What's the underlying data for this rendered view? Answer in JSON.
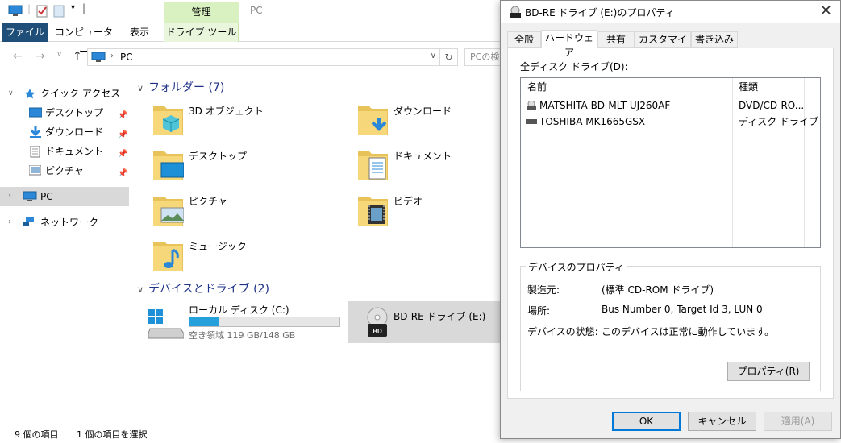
{
  "explorer": {
    "title": "PC",
    "ribbon_context": "管理",
    "tabs": [
      "ファイル",
      "コンピューター",
      "表示",
      "ドライブ ツール"
    ],
    "address": "PC",
    "search_placeholder": "PCの検",
    "nav": {
      "quick_access": "クイック アクセス",
      "desktop": "デスクトップ",
      "downloads": "ダウンロード",
      "documents": "ドキュメント",
      "pictures": "ピクチャ",
      "pc": "PC",
      "network": "ネットワーク"
    },
    "folders_header": "フォルダー (7)",
    "folders": [
      "3D オブジェクト",
      "ダウンロード",
      "デスクトップ",
      "ドキュメント",
      "ピクチャ",
      "ビデオ",
      "ミュージック"
    ],
    "devices_header": "デバイスとドライブ (2)",
    "drive_c": {
      "name": "ローカル ディスク (C:)",
      "free": "空き領域 119 GB/148 GB",
      "used_fraction": 0.196
    },
    "drive_e": {
      "name": "BD-RE ドライブ (E:)"
    },
    "status": {
      "items": "9 個の項目",
      "selected": "1 個の項目を選択"
    }
  },
  "dialog": {
    "title": "BD-RE ドライブ (E:)のプロパティ",
    "tabs": [
      "全般",
      "ハードウェア",
      "共有",
      "カスタマイズ",
      "書き込み"
    ],
    "list_label": "全ディスク ドライブ(D):",
    "columns": [
      "名前",
      "種類"
    ],
    "rows": [
      {
        "name": "MATSHITA BD-MLT UJ260AF",
        "type": "DVD/CD-RO..."
      },
      {
        "name": "TOSHIBA MK1665GSX",
        "type": "ディスク ドライブ"
      }
    ],
    "props_legend": "デバイスのプロパティ",
    "props": [
      {
        "label": "製造元:",
        "value": "(標準 CD-ROM ドライブ)"
      },
      {
        "label": "場所:",
        "value": "Bus Number 0, Target Id 3, LUN 0"
      },
      {
        "label": "デバイスの状態:",
        "value": "このデバイスは正常に動作しています。"
      }
    ],
    "properties_button": "プロパティ(R)",
    "ok": "OK",
    "cancel": "キャンセル",
    "apply": "適用(A)"
  },
  "colors": {
    "accent": "#0078d7",
    "file_tab": "#1f4e79",
    "manage_tab": "#d9f0c0",
    "drive_fill": "#26a0da"
  }
}
